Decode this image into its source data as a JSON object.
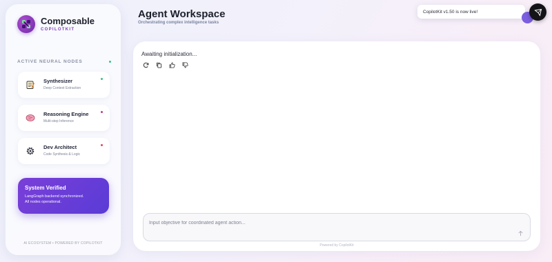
{
  "sidebar": {
    "brand": {
      "name": "Composable",
      "sub": "COPILOTKIT"
    },
    "section_title": "ACTIVE NEURAL NODES",
    "nodes": [
      {
        "title": "Synthesizer",
        "desc": "Deep Context Extraction",
        "icon": "notepad-icon",
        "dot_color": "#35c08a"
      },
      {
        "title": "Reasoning Engine",
        "desc": "Multi-step Inference",
        "icon": "brain-icon",
        "dot_color": "#c0398a"
      },
      {
        "title": "Dev Architect",
        "desc": "Code Synthesis & Logic",
        "icon": "gear-icon",
        "dot_color": "#e0455a"
      }
    ],
    "verified": {
      "title": "System Verified",
      "line1": "LangGraph backend synchronized.",
      "line2": "All nodes operational."
    },
    "footer": "AI ECOSYSTEM • POWERED BY COPILOTKIT"
  },
  "header": {
    "title": "Agent Workspace",
    "subtitle": "Orchestrating complex intelligence tasks"
  },
  "toast": {
    "text": "CopilotKit v1.50 is now live!"
  },
  "chat": {
    "status": "Awaiting initialization...",
    "actions": [
      "regenerate-icon",
      "copy-icon",
      "thumbs-up-icon",
      "thumbs-down-icon"
    ],
    "input_placeholder": "Input objective for coordinated agent action...",
    "input_value": "",
    "powered_by": "Powered by CopilotKit"
  },
  "colors": {
    "accent_purple": "#6a3dd8",
    "brand_purple": "#7a3bb6",
    "status_green": "#35c08a"
  }
}
